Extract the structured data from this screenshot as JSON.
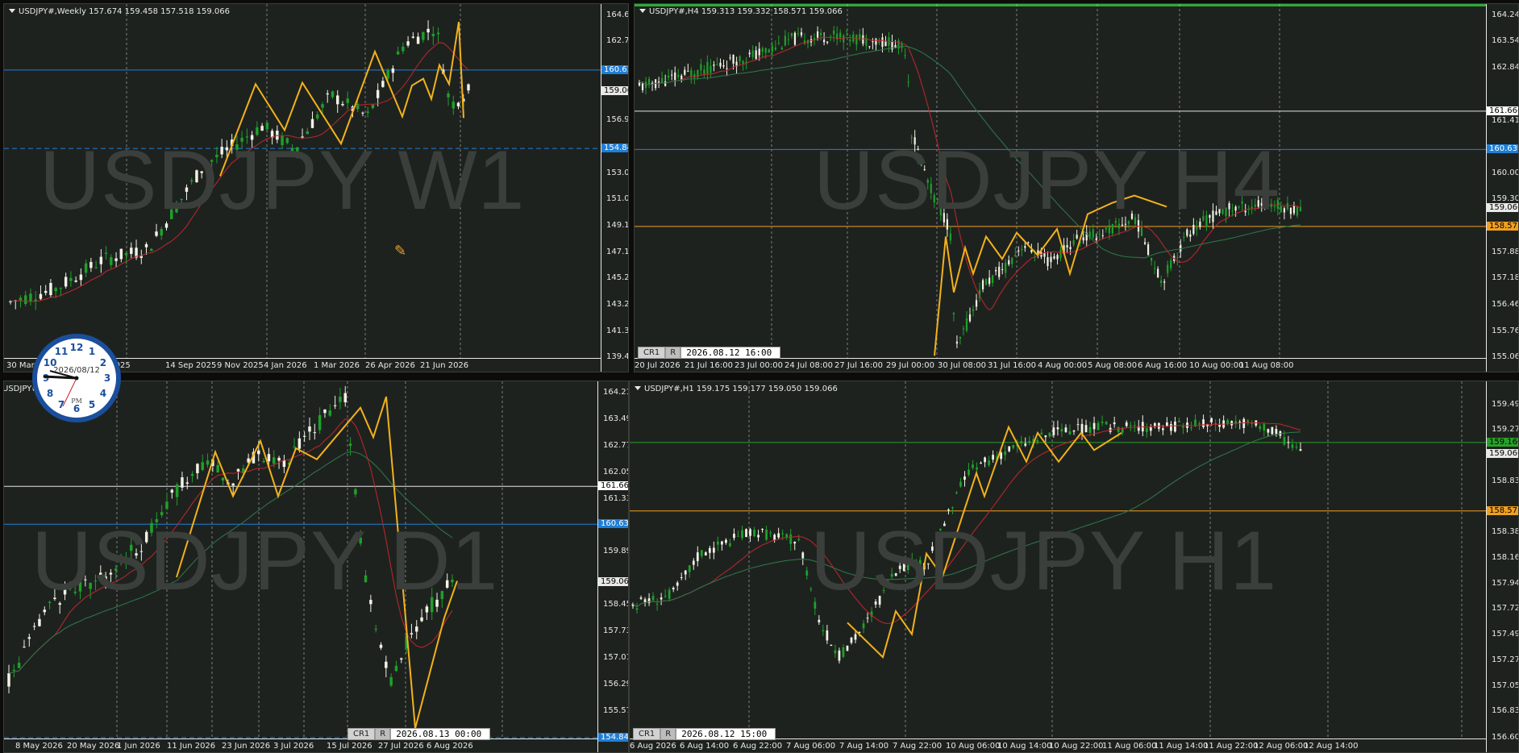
{
  "colors": {
    "panel_bg": "#1e221f",
    "bull": "#f2f2e6",
    "bear": "#1fa02a",
    "ma_fast": "#c2262b",
    "ma_slow": "#2e7a4a",
    "zigzag": "#f2b21a",
    "hline_blue": "#1e7fd6",
    "hline_white": "#e6e6e6",
    "hline_orange": "#f0a020",
    "hline_green": "#2aa02a",
    "grid": "#c9c9c9"
  },
  "panels": {
    "weekly": {
      "title": "USDJPY#,Weekly  157.674 159.458 157.518 159.066",
      "watermark": "USDJPY W1",
      "price_ticks": [
        "164.680",
        "162.755",
        "160.639",
        "159.066",
        "156.925",
        "154.846",
        "153.020",
        "151.095",
        "149.115",
        "147.190",
        "145.265",
        "143.285",
        "141.360",
        "139.435"
      ],
      "time_ticks": [
        "30 Mar",
        "Jul 2025",
        "14 Sep 2025",
        "9 Nov 2025",
        "4 Jan 2026",
        "1 Mar 2026",
        "26 Apr 2026",
        "21 Jun 2026"
      ],
      "tags": {
        "blue_solid": "160.639",
        "current": "159.066",
        "blue_dashed": "154.846"
      },
      "price_range": [
        139.435,
        164.68
      ]
    },
    "h4": {
      "title": "USDJPY#,H4  159.313 159.332 158.571 159.066",
      "watermark": "USDJPY H4",
      "price_ticks": [
        "164.240",
        "163.540",
        "162.840",
        "161.666",
        "161.410",
        "160.639",
        "160.000",
        "159.300",
        "159.066",
        "158.571",
        "157.880",
        "157.180",
        "156.460",
        "155.760",
        "155.060"
      ],
      "time_ticks": [
        "20 Jul 2026",
        "21 Jul 16:00",
        "23 Jul 00:00",
        "24 Jul 08:00",
        "27 Jul 16:00",
        "29 Jul 00:00",
        "30 Jul 08:00",
        "31 Jul 16:00",
        "4 Aug 00:00",
        "5 Aug 08:00",
        "6 Aug 16:00",
        "10 Aug 00:00",
        "11 Aug 08:00"
      ],
      "tags": {
        "white": "161.666",
        "blue": "160.639",
        "current": "159.066",
        "orange": "158.571"
      },
      "status": {
        "cr": "CR1",
        "r": "R",
        "datetime": "2026.08.12  16:00"
      },
      "price_range": [
        155.06,
        164.24
      ]
    },
    "daily": {
      "title": "USDJPY#,Daily  159.066",
      "watermark": "USDJPY D1",
      "price_ticks": [
        "164.210",
        "163.490",
        "162.770",
        "162.050",
        "161.666",
        "161.330",
        "160.639",
        "159.890",
        "159.066",
        "158.450",
        "157.730",
        "157.010",
        "156.290",
        "155.570",
        "154.846"
      ],
      "time_ticks": [
        "8 May 2026",
        "20 May 2026",
        "1 Jun 2026",
        "11 Jun 2026",
        "23 Jun 2026",
        "3 Jul 2026",
        "15 Jul 2026",
        "27 Jul 2026",
        "6 Aug 2026"
      ],
      "tags": {
        "white": "161.666",
        "blue": "160.639",
        "current": "159.066",
        "blue_bottom": "154.846"
      },
      "status": {
        "cr": "CR1",
        "r": "R",
        "datetime": "2026.08.13  00:00"
      },
      "price_range": [
        154.846,
        164.21
      ]
    },
    "h1": {
      "title": "USDJPY#,H1  159.175 159.177 159.050 159.066",
      "watermark": "USDJPY H1",
      "price_ticks": [
        "159.495",
        "159.275",
        "159.066",
        "158.830",
        "158.571",
        "158.385",
        "158.160",
        "157.940",
        "157.720",
        "157.495",
        "157.275",
        "157.050",
        "156.830",
        "156.600"
      ],
      "time_ticks": [
        "6 Aug 2026",
        "6 Aug 14:00",
        "6 Aug 22:00",
        "7 Aug 06:00",
        "7 Aug 14:00",
        "7 Aug 22:00",
        "10 Aug 06:00",
        "10 Aug 14:00",
        "10 Aug 22:00",
        "11 Aug 06:00",
        "11 Aug 14:00",
        "11 Aug 22:00",
        "12 Aug 06:00",
        "12 Aug 14:00"
      ],
      "tags": {
        "green": "159.166",
        "current": "159.066",
        "orange": "158.571"
      },
      "status": {
        "cr": "CR1",
        "r": "R",
        "datetime": "2026.08.12  15:00"
      },
      "price_range": [
        156.6,
        159.6
      ]
    }
  },
  "clock": {
    "date": "2026/08/12",
    "ampm": "PM",
    "numerals": [
      "12",
      "1",
      "2",
      "3",
      "4",
      "5",
      "6",
      "7",
      "8",
      "9",
      "10",
      "11"
    ]
  }
}
